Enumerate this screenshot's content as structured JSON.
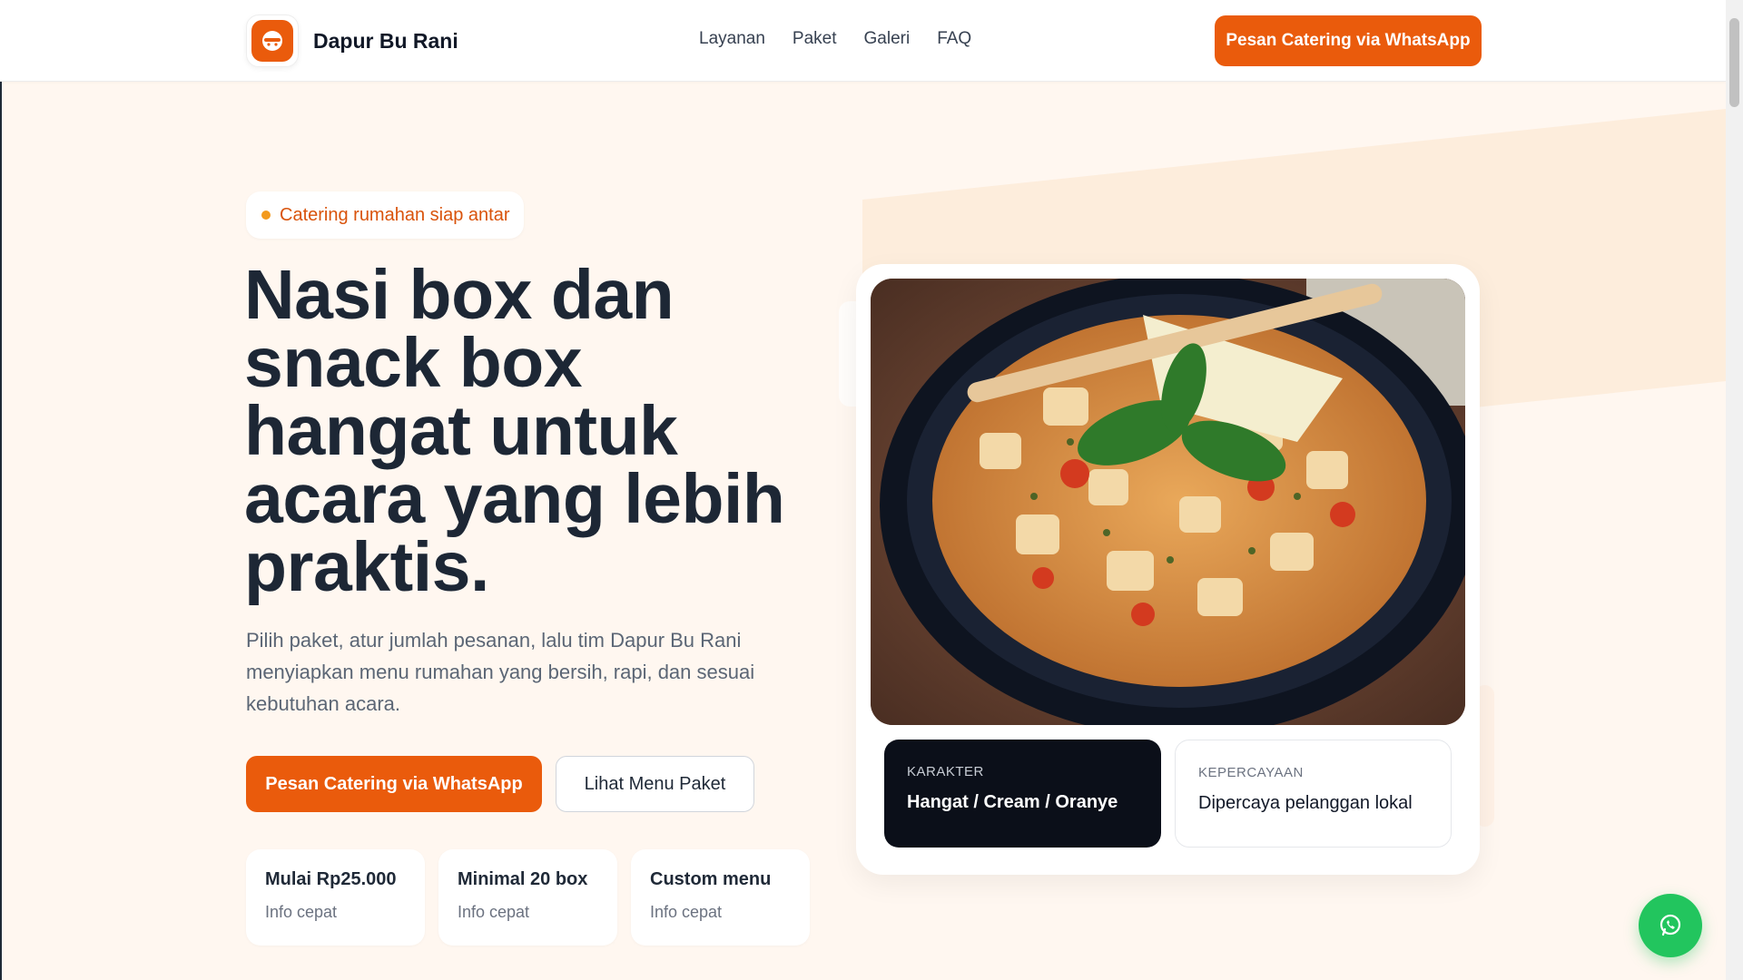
{
  "header": {
    "brand_name": "Dapur Bu Rani",
    "nav": [
      "Layanan",
      "Paket",
      "Galeri",
      "FAQ"
    ],
    "cta_label": "Pesan Catering via WhatsApp"
  },
  "hero": {
    "badge": "Catering rumahan siap antar",
    "title": "Nasi box dan snack box hangat untuk acara yang lebih praktis.",
    "description": "Pilih paket, atur jumlah pesanan, lalu tim Dapur Bu Rani menyiapkan menu rumahan yang bersih, rapi, dan sesuai kebutuhan acara.",
    "primary_button": "Pesan Catering via WhatsApp",
    "secondary_button": "Lihat Menu Paket",
    "info_cards": [
      {
        "title": "Mulai Rp25.000",
        "subtitle": "Info cepat"
      },
      {
        "title": "Minimal 20 box",
        "subtitle": "Info cepat"
      },
      {
        "title": "Custom menu",
        "subtitle": "Info cepat"
      }
    ]
  },
  "image_card": {
    "stats": [
      {
        "label": "KARAKTER",
        "value": "Hangat / Cream / Oranye"
      },
      {
        "label": "KEPERCAYAAN",
        "value": "Dipercaya pelanggan lokal"
      }
    ]
  },
  "colors": {
    "accent": "#ea5b0c",
    "background": "#fff7f0",
    "whatsapp": "#22c55e"
  },
  "icons": {
    "logo": "chef-food-icon",
    "float": "whatsapp-icon"
  }
}
